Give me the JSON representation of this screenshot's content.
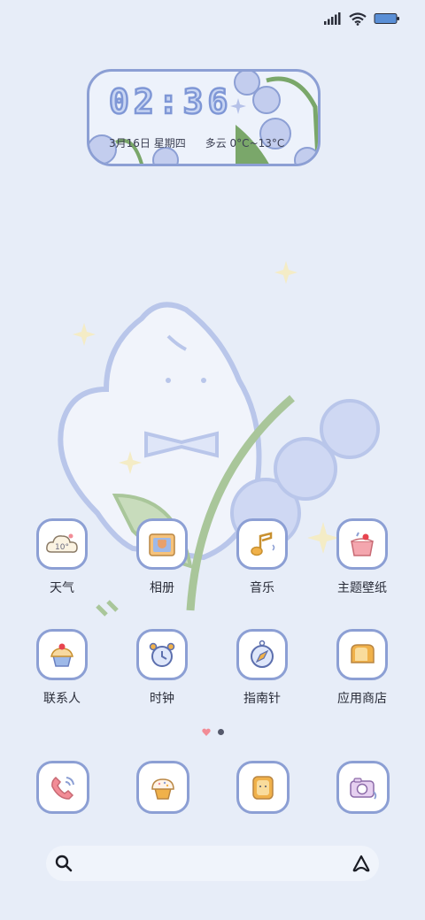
{
  "clock": {
    "time": "02:36",
    "date": "3月16日 星期四",
    "weather": "多云 0°C~13°C"
  },
  "weather_icon_temp": "10°",
  "apps": [
    {
      "label": "天气",
      "icon": "weather-cloud-icon"
    },
    {
      "label": "相册",
      "icon": "photo-album-icon"
    },
    {
      "label": "音乐",
      "icon": "music-note-icon"
    },
    {
      "label": "主题壁纸",
      "icon": "cake-icon"
    },
    {
      "label": "联系人",
      "icon": "cupcake-icon"
    },
    {
      "label": "时钟",
      "icon": "alarm-clock-icon"
    },
    {
      "label": "指南针",
      "icon": "compass-icon"
    },
    {
      "label": "应用商店",
      "icon": "toast-icon"
    }
  ],
  "dock": [
    {
      "icon": "phone-icon"
    },
    {
      "icon": "muffin-icon"
    },
    {
      "icon": "toast-bread-icon"
    },
    {
      "icon": "camera-icon"
    }
  ],
  "page_indicator": {
    "pages": 2,
    "current": 1
  },
  "colors": {
    "background": "#e7edf8",
    "tile_border": "#8c9fd4",
    "accent_pink": "#f28c96"
  }
}
